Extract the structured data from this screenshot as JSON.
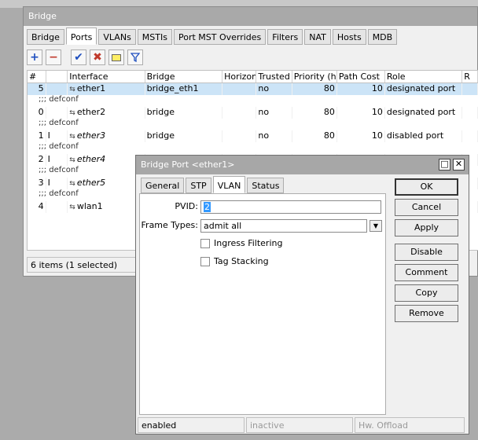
{
  "bridge_window": {
    "title": "Bridge",
    "tabs": [
      "Bridge",
      "Ports",
      "VLANs",
      "MSTIs",
      "Port MST Overrides",
      "Filters",
      "NAT",
      "Hosts",
      "MDB"
    ],
    "active_tab": "Ports",
    "columns": [
      "#",
      "Interface",
      "Bridge",
      "Horizon",
      "Trusted",
      "Priority (h...",
      "Path Cost",
      "Role",
      "R"
    ],
    "rows": [
      {
        "comment": "",
        "num": "5",
        "flag": "",
        "interface": "ether1",
        "bridge": "bridge_eth1",
        "horizon": "",
        "trusted": "no",
        "priority": "80",
        "path_cost": "10",
        "role": "designated port",
        "selected": true,
        "italic": false
      },
      {
        "comment": ";;; defconf",
        "num": "0",
        "flag": "",
        "interface": "ether2",
        "bridge": "bridge",
        "horizon": "",
        "trusted": "no",
        "priority": "80",
        "path_cost": "10",
        "role": "designated port",
        "selected": false,
        "italic": false
      },
      {
        "comment": ";;; defconf",
        "num": "1",
        "flag": "I",
        "interface": "ether3",
        "bridge": "bridge",
        "horizon": "",
        "trusted": "no",
        "priority": "80",
        "path_cost": "10",
        "role": "disabled port",
        "selected": false,
        "italic": true
      },
      {
        "comment": ";;; defconf",
        "num": "2",
        "flag": "I",
        "interface": "ether4",
        "bridge": "",
        "horizon": "",
        "trusted": "",
        "priority": "",
        "path_cost": "",
        "role": "",
        "selected": false,
        "italic": true
      },
      {
        "comment": ";;; defconf",
        "num": "3",
        "flag": "I",
        "interface": "ether5",
        "bridge": "",
        "horizon": "",
        "trusted": "",
        "priority": "",
        "path_cost": "",
        "role": "",
        "selected": false,
        "italic": true
      },
      {
        "comment": ";;; defconf",
        "num": "4",
        "flag": "",
        "interface": "wlan1",
        "bridge": "",
        "horizon": "",
        "trusted": "",
        "priority": "",
        "path_cost": "",
        "role": "",
        "selected": false,
        "italic": false
      }
    ],
    "status": "6 items (1 selected)"
  },
  "dialog": {
    "title": "Bridge Port <ether1>",
    "tabs": [
      "General",
      "STP",
      "VLAN",
      "Status"
    ],
    "active_tab": "VLAN",
    "pvid_label": "PVID:",
    "pvid_value": "2",
    "frame_types_label": "Frame Types:",
    "frame_types_value": "admit all",
    "ingress_filtering_label": "Ingress Filtering",
    "tag_stacking_label": "Tag Stacking",
    "buttons": {
      "ok": "OK",
      "cancel": "Cancel",
      "apply": "Apply",
      "disable": "Disable",
      "comment": "Comment",
      "copy": "Copy",
      "remove": "Remove"
    },
    "status": {
      "enabled": "enabled",
      "inactive": "inactive",
      "hw_offload": "Hw. Offload"
    }
  },
  "colors": {
    "title_bar": "#a9a9a9",
    "selected_row": "#cce4f7",
    "add_icon": "#1f4fbf",
    "remove_icon": "#c0392b"
  }
}
